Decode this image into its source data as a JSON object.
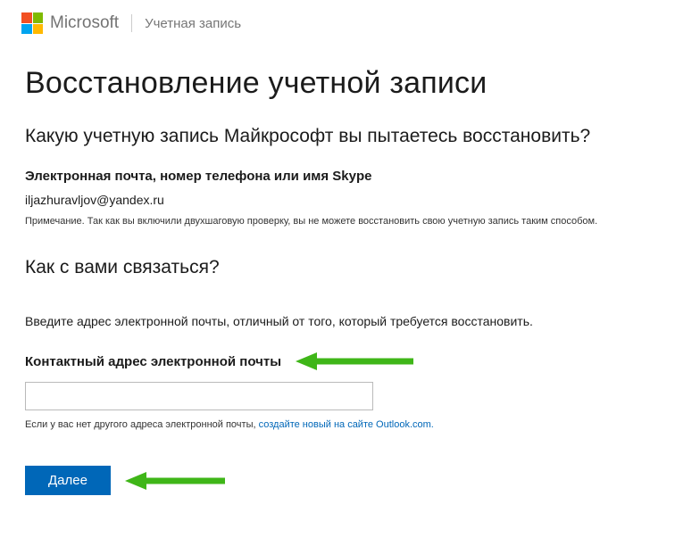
{
  "header": {
    "brand": "Microsoft",
    "subtitle": "Учетная запись"
  },
  "page": {
    "title": "Восстановление учетной записи",
    "section1_title": "Какую учетную запись Майкрософт вы пытаетесь восстановить?",
    "identifier_label": "Электронная почта, номер телефона или имя Skype",
    "identifier_value": "iljazhuravljov@yandex.ru",
    "note": "Примечание. Так как вы включили двухшаговую проверку, вы не можете восстановить свою учетную запись таким способом.",
    "section2_title": "Как с вами связаться?",
    "instruction": "Введите адрес электронной почты, отличный от того, который требуется восстановить.",
    "contact_label": "Контактный адрес электронной почты",
    "contact_value": "",
    "hint_prefix": "Если у вас нет другого адреса электронной почты, ",
    "hint_link": "создайте новый на сайте Outlook.com.",
    "next_button": "Далее"
  }
}
